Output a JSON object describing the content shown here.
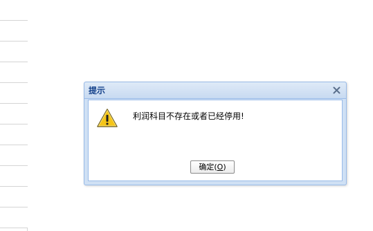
{
  "dialog": {
    "title": "提示",
    "message": "利润科目不存在或者已经停用!",
    "ok_label_prefix": "确定(",
    "ok_label_mnemonic": "O",
    "ok_label_suffix": ")",
    "icon": "warning-icon",
    "close_icon": "close-icon"
  },
  "colors": {
    "header_text": "#15428b",
    "border": "#99bbe8",
    "warning_fill": "#f5c518"
  }
}
